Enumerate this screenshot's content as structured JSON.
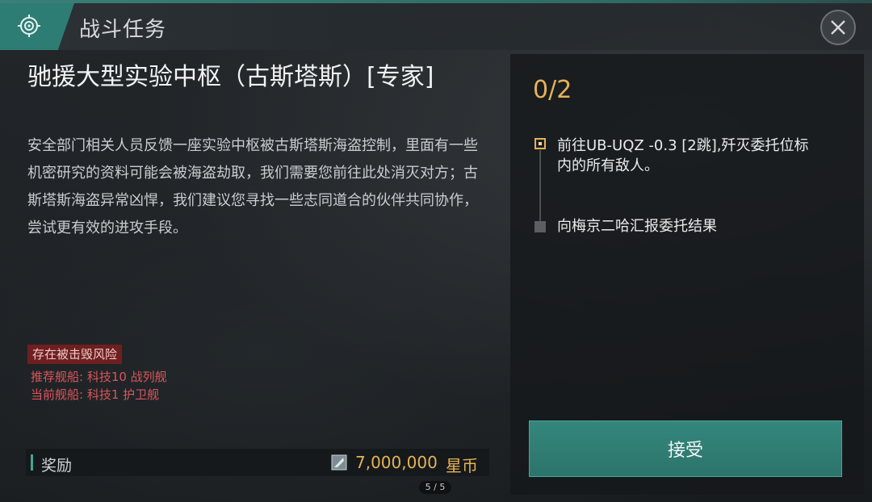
{
  "header": {
    "title": "战斗任务",
    "badge_icon": "radar-icon",
    "close_icon": "close-icon"
  },
  "mission": {
    "title": "驰援大型实验中枢（古斯塔斯）[专家]",
    "description": "安全部门相关人员反馈一座实验中枢被古斯塔斯海盗控制，里面有一些机密研究的资料可能会被海盗劫取，我们需要您前往此处消灭对方；古斯塔斯海盗异常凶悍，我们建议您寻找一些志同道合的伙伴共同协作，尝试更有效的进攻手段。",
    "risk_label": "存在被击毁风险",
    "recommended_ship": "推荐舰船: 科技10 战列舰",
    "current_ship": "当前舰船: 科技1 护卫舰"
  },
  "reward": {
    "label": "奖励",
    "amount": "7,000,000",
    "unit": "星币",
    "icon": "star-coin-icon"
  },
  "objectives": {
    "progress": "0/2",
    "items": [
      {
        "text": "前往UB-UQZ -0.3 [2跳],歼灭委托位标内的所有敌人。",
        "status": "active"
      },
      {
        "text": "向梅京二哈汇报委托结果",
        "status": "pending"
      }
    ]
  },
  "actions": {
    "accept_label": "接受"
  },
  "pagination": {
    "label": "5 / 5"
  },
  "colors": {
    "accent": "#2e7d75",
    "gold": "#e4b357",
    "danger": "#d9555a"
  }
}
